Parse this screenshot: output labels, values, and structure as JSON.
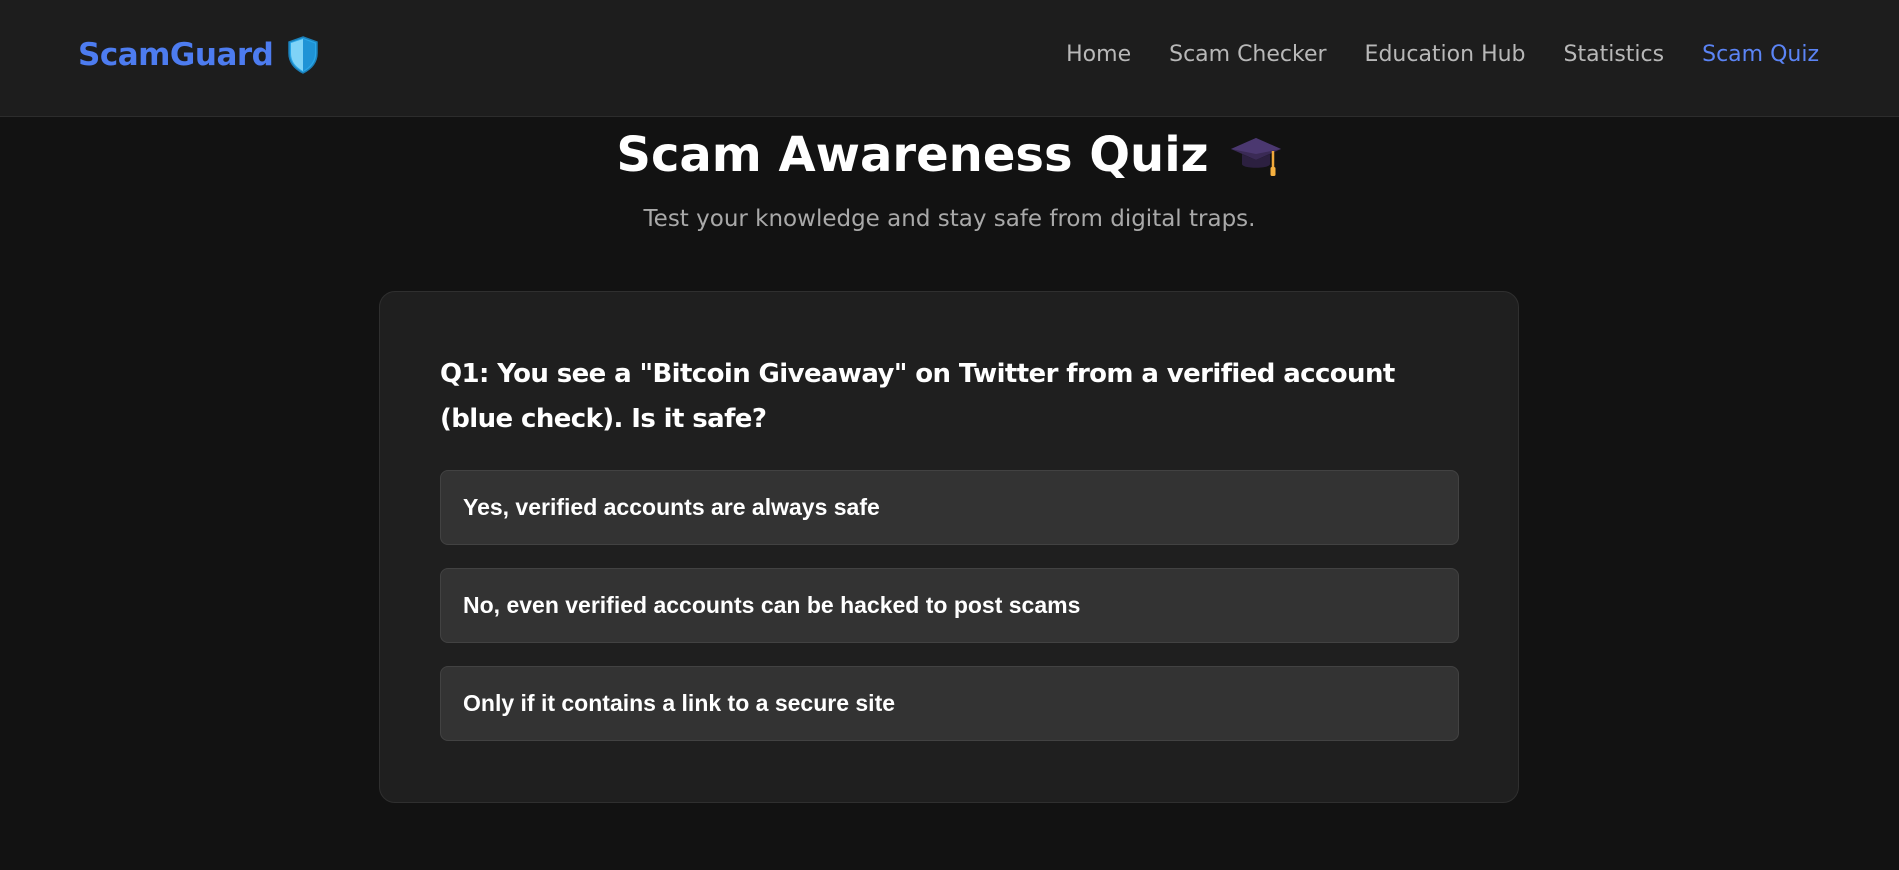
{
  "brand": {
    "name": "ScamGuard",
    "icon": "shield-icon",
    "color": "#4d7cf0"
  },
  "nav": {
    "items": [
      {
        "label": "Home",
        "active": false
      },
      {
        "label": "Scam Checker",
        "active": false
      },
      {
        "label": "Education Hub",
        "active": false
      },
      {
        "label": "Statistics",
        "active": false
      },
      {
        "label": "Scam Quiz",
        "active": true
      }
    ],
    "active_color": "#5b84f5"
  },
  "header": {
    "title": "Scam Awareness Quiz",
    "title_icon": "graduation-cap-icon",
    "subtitle": "Test your knowledge and stay safe from digital traps."
  },
  "quiz": {
    "question": "Q1: You see a \"Bitcoin Giveaway\" on Twitter from a verified account (blue check). Is it safe?",
    "options": [
      "Yes, verified accounts are always safe",
      "No, even verified accounts can be hacked to post scams",
      "Only if it contains a link to a secure site"
    ]
  },
  "colors": {
    "background": "#121212",
    "navbar": "#1d1d1d",
    "card": "#1f1f1f",
    "option": "#333333"
  }
}
